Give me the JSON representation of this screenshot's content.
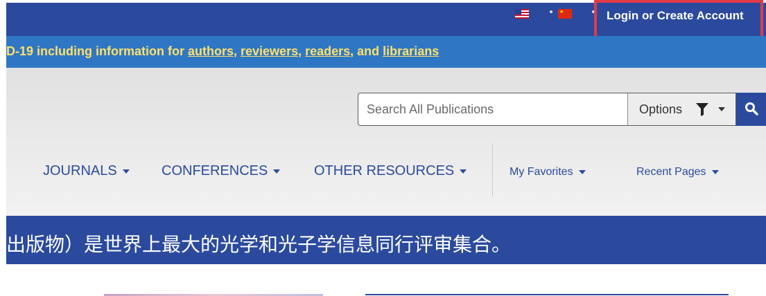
{
  "topbar": {
    "language_flags": [
      "flag-us-icon",
      "flag-china-icon"
    ],
    "login_label": "Login or Create Account"
  },
  "notice": {
    "prefix": "D-19 including information for ",
    "link_authors": "authors,",
    "link_reviewers": "reviewers,",
    "link_readers": "readers",
    "sep_and": ", and ",
    "link_librarians": "librarians"
  },
  "search": {
    "placeholder": "Search All Publications",
    "options_label": "Options",
    "icons": [
      "filter-icon",
      "search-icon"
    ]
  },
  "nav": {
    "journals": "JOURNALS",
    "conferences": "CONFERENCES",
    "other_resources": "OTHER RESOURCES",
    "my_favorites": "My Favorites",
    "recent_pages": "Recent Pages"
  },
  "banner": {
    "text": "出版物）是世界上最大的光学和光子学信息同行评审集合。"
  },
  "colors": {
    "brand_blue": "#2b4a9e",
    "notice_blue": "#2f77c4",
    "notice_text": "#ffe06a",
    "highlight_red": "#e33b45"
  }
}
